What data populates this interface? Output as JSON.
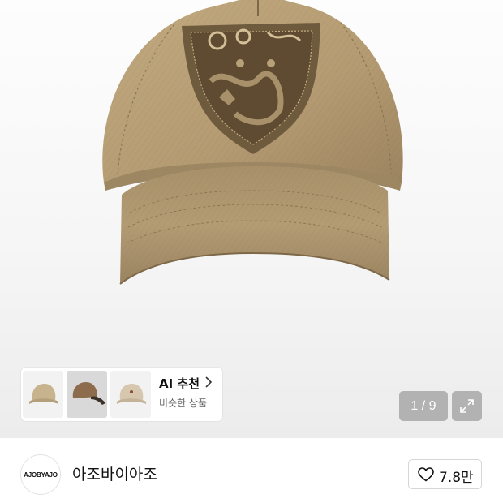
{
  "product_image": {
    "image_counter": "1 / 9",
    "colors": {
      "cap_base": "#b8a078",
      "cap_shadow": "#8f7a55",
      "patch": "#6e5a3c",
      "patch_light": "#c4ad82"
    }
  },
  "ai_recommend": {
    "title": "AI 추천",
    "subtitle": "비슷한 상품",
    "thumbnails": [
      {
        "name": "beige-cap",
        "color": "#c7b48f"
      },
      {
        "name": "brown-cap",
        "color": "#8c6c4c"
      },
      {
        "name": "light-cap",
        "color": "#d6c7ae"
      }
    ]
  },
  "shop": {
    "logo_text": "AJOBYAJO",
    "name": "아조바이아조",
    "like_count": "7.8만"
  },
  "icons": {
    "expand": "expand-arrows-icon",
    "heart": "heart-outline-icon",
    "chevron": "chevron-right-icon"
  }
}
